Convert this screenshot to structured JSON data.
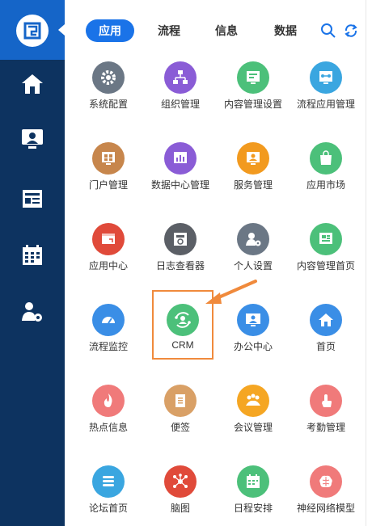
{
  "tabs": {
    "items": [
      {
        "label": "应用",
        "active": true
      },
      {
        "label": "流程",
        "active": false
      },
      {
        "label": "信息",
        "active": false
      },
      {
        "label": "数据",
        "active": false
      }
    ]
  },
  "colors": {
    "sidebar": "#0d3360",
    "sidebar_active": "#1565c8",
    "tab_active": "#1a73e8",
    "highlight": "#f08a3c"
  },
  "sidebar": {
    "icons": [
      "logo-icon",
      "home-icon",
      "monitor-user-icon",
      "news-icon",
      "calendar-icon",
      "user-gear-icon"
    ]
  },
  "apps": {
    "row1": [
      "系统配置",
      "组织管理",
      "内容管理设置",
      "流程应用管理"
    ],
    "row2": [
      "门户管理",
      "数据中心管理",
      "服务管理",
      "应用市场"
    ],
    "row3": [
      "应用中心",
      "日志查看器",
      "个人设置",
      "内容管理首页"
    ],
    "row4": [
      "流程监控",
      "CRM",
      "办公中心",
      "首页"
    ],
    "row5": [
      "热点信息",
      "便签",
      "会议管理",
      "考勤管理"
    ],
    "row6": [
      "论坛首页",
      "脑图",
      "日程安排",
      "神经网络模型"
    ]
  }
}
